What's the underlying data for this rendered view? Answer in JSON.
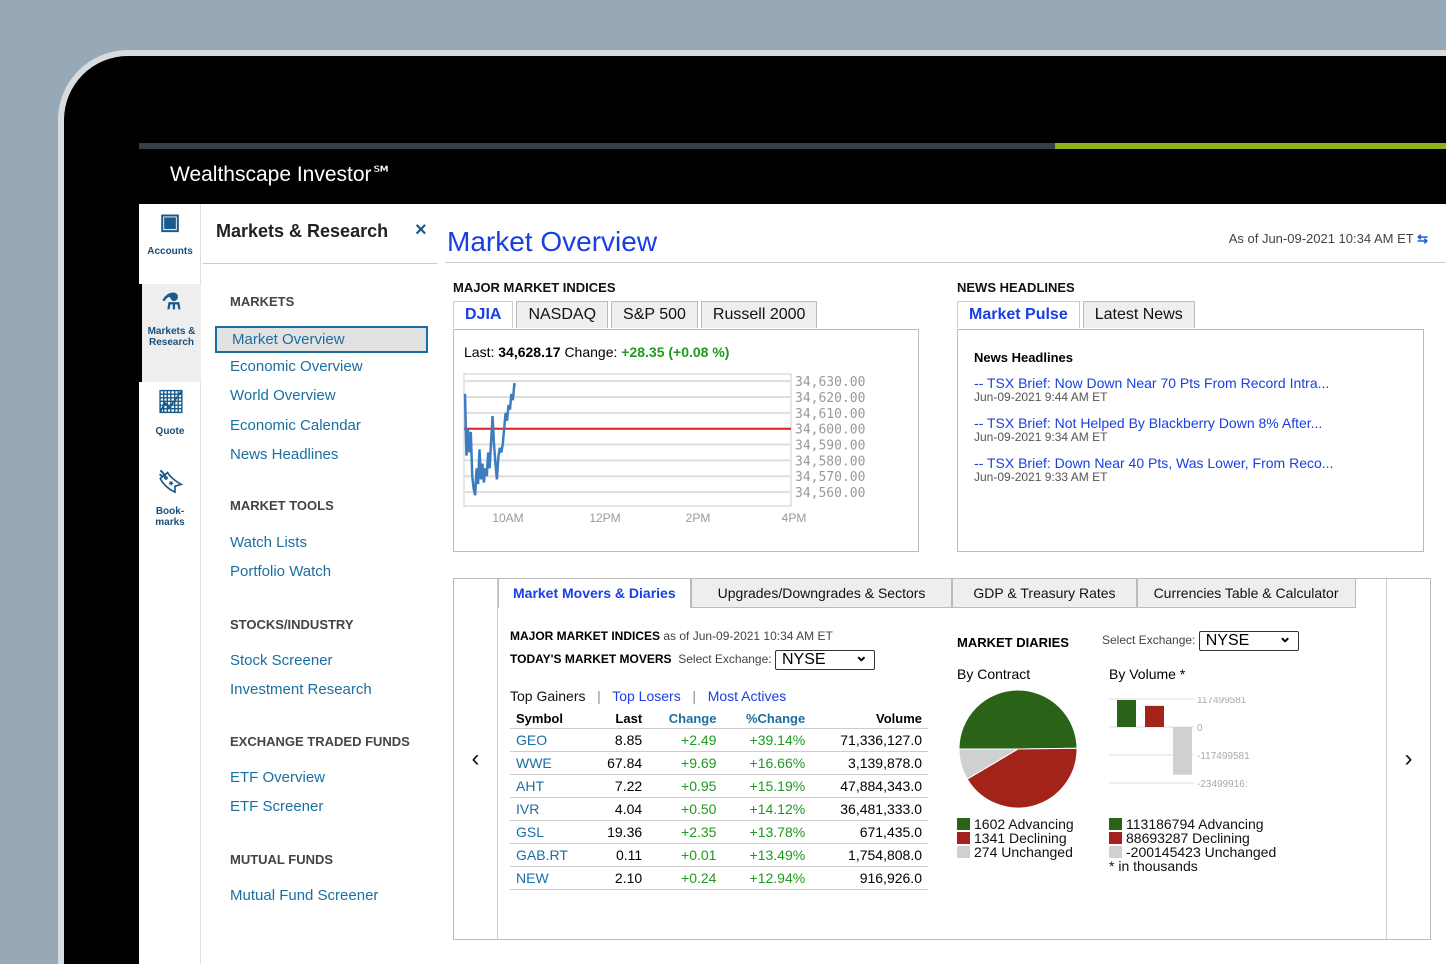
{
  "app": {
    "brand": "Wealthscape Investor℠"
  },
  "rail": [
    {
      "label": "Accounts"
    },
    {
      "label": "Markets & Research"
    },
    {
      "label": "Quote"
    },
    {
      "label": "Book-marks"
    }
  ],
  "nav": {
    "title": "Markets & Research",
    "close": "×",
    "sections": [
      {
        "title": "MARKETS",
        "items": [
          "Market Overview",
          "Economic Overview",
          "World Overview",
          "Economic Calendar",
          "News Headlines"
        ]
      },
      {
        "title": "MARKET TOOLS",
        "items": [
          "Watch Lists",
          "Portfolio Watch"
        ]
      },
      {
        "title": "STOCKS/INDUSTRY",
        "items": [
          "Stock Screener",
          "Investment Research"
        ]
      },
      {
        "title": "EXCHANGE TRADED FUNDS",
        "items": [
          "ETF Overview",
          "ETF Screener"
        ]
      },
      {
        "title": "MUTUAL FUNDS",
        "items": [
          "Mutual Fund Screener"
        ]
      }
    ]
  },
  "main": {
    "title": "Market Overview",
    "as_of": "As of Jun-09-2021  10:34 AM ET"
  },
  "indices": {
    "label": "MAJOR MARKET INDICES",
    "tabs": [
      "DJIA",
      "NASDAQ",
      "S&P 500",
      "Russell 2000"
    ],
    "last_label": "Last:",
    "last": "34,628.17",
    "change_label": "Change:",
    "change": "+28.35 (+0.08 %)"
  },
  "chart_data": {
    "type": "line",
    "title": "DJIA intraday",
    "x_ticks": [
      "10AM",
      "12PM",
      "2PM",
      "4PM"
    ],
    "y_ticks": [
      "34,630.00",
      "34,620.00",
      "34,610.00",
      "34,600.00",
      "34,590.00",
      "34,580.00",
      "34,570.00",
      "34,560.00"
    ],
    "ylim": [
      34555,
      34632
    ],
    "reference": 34600,
    "series": [
      {
        "name": "DJIA",
        "x_minutes": [
          0,
          1,
          2,
          3,
          4,
          5,
          6,
          7,
          8,
          9,
          10,
          11,
          12,
          13,
          14,
          15,
          16,
          17,
          18,
          19,
          20,
          21,
          22,
          23,
          24,
          25,
          26,
          27,
          28,
          29,
          30,
          31,
          32,
          33,
          34,
          35
        ],
        "values": [
          34622,
          34583,
          34600,
          34585,
          34598,
          34570,
          34562,
          34558,
          34575,
          34565,
          34587,
          34568,
          34578,
          34566,
          34575,
          34570,
          34585,
          34575,
          34592,
          34608,
          34590,
          34578,
          34568,
          34582,
          34588,
          34585,
          34590,
          34600,
          34610,
          34605,
          34615,
          34612,
          34622,
          34618,
          34628,
          34628
        ]
      }
    ]
  },
  "news": {
    "label": "NEWS HEADLINES",
    "tabs": [
      "Market Pulse",
      "Latest News"
    ],
    "heading": "News Headlines",
    "items": [
      {
        "title": "-- TSX Brief: Now Down Near 70 Pts From Record Intra...",
        "date": "Jun-09-2021 9:44 AM ET"
      },
      {
        "title": "-- TSX Brief: Not Helped By Blackberry Down 8% After...",
        "date": "Jun-09-2021 9:34 AM ET"
      },
      {
        "title": "-- TSX Brief: Down Near 40 Pts, Was Lower, From Reco...",
        "date": "Jun-09-2021 9:33 AM ET"
      }
    ]
  },
  "lower": {
    "tabs": [
      "Market Movers & Diaries",
      "Upgrades/Downgrades & Sectors",
      "GDP & Treasury Rates",
      "Currencies Table & Calculator"
    ],
    "mmi_label": "MAJOR MARKET INDICES",
    "mmi_asof": "as of Jun-09-2021  10:34 AM ET",
    "movers_label": "TODAY'S MARKET MOVERS",
    "select_label": "Select Exchange:",
    "exchange": "NYSE",
    "subtabs": [
      "Top Gainers",
      "Top Losers",
      "Most Actives"
    ],
    "sep": "|",
    "columns": [
      "Symbol",
      "Last",
      "Change",
      "%Change",
      "Volume"
    ],
    "rows": [
      [
        "GEO",
        "8.85",
        "+2.49",
        "+39.14%",
        "71,336,127.0"
      ],
      [
        "WWE",
        "67.84",
        "+9.69",
        "+16.66%",
        "3,139,878.0"
      ],
      [
        "AHT",
        "7.22",
        "+0.95",
        "+15.19%",
        "47,884,343.0"
      ],
      [
        "IVR",
        "4.04",
        "+0.50",
        "+14.12%",
        "36,481,333.0"
      ],
      [
        "GSL",
        "19.36",
        "+2.35",
        "+13.78%",
        "671,435.0"
      ],
      [
        "GAB.RT",
        "0.11",
        "+0.01",
        "+13.49%",
        "1,754,808.0"
      ],
      [
        "NEW",
        "2.10",
        "+0.24",
        "+12.94%",
        "916,926.0"
      ]
    ],
    "diaries": {
      "label": "MARKET DIARIES",
      "select_label": "Select Exchange:",
      "exchange": "NYSE",
      "by_contract": "By Contract",
      "by_volume": "By Volume *",
      "contract": [
        {
          "value": 1602,
          "label": "1602 Advancing",
          "color": "#2a6318"
        },
        {
          "value": 1341,
          "label": "1341 Declining",
          "color": "#a3231b"
        },
        {
          "value": 274,
          "label": "274 Unchanged",
          "color": "#d0d0d0"
        }
      ],
      "volume": [
        {
          "value": 113186794,
          "label": "113186794 Advancing",
          "color": "#2a6318"
        },
        {
          "value": 88693287,
          "label": "88693287 Declining",
          "color": "#a3231b"
        },
        {
          "value": -200145423,
          "label": "-200145423 Unchanged",
          "color": "#d0d0d0"
        }
      ],
      "volume_ticks": [
        "117499581",
        "0",
        "-117499581",
        "-23499916:"
      ],
      "footnote": "* in thousands"
    }
  }
}
